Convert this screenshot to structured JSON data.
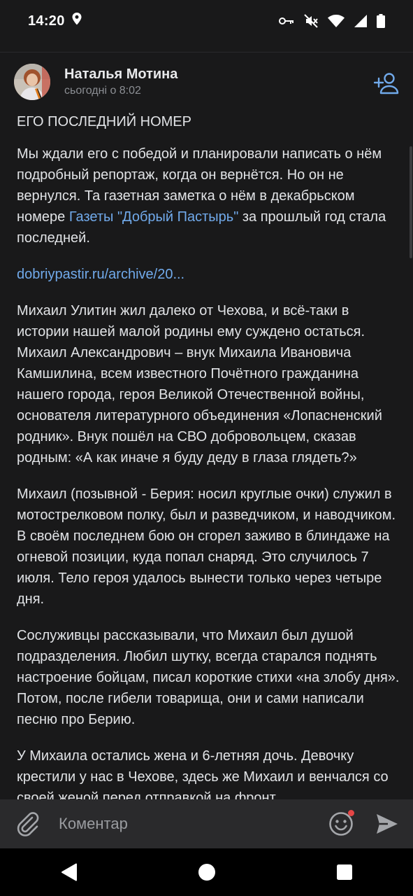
{
  "status_bar": {
    "time": "14:20",
    "icons": [
      "location-icon",
      "key-icon",
      "mute-icon",
      "wifi-icon",
      "signal-icon",
      "battery-icon"
    ]
  },
  "post": {
    "author_name": "Наталья Мотина",
    "time": "сьогодні о 8:02",
    "title": "ЕГО ПОСЛЕДНИЙ НОМЕР",
    "p1_before": "Мы ждали его с победой и планировали написать о нём подробный репортаж, когда он вернётся. Но он не вернулся. Та газетная заметка о нём в декабрьском номере ",
    "p1_link": "Газеты \"Добрый Пастырь\"",
    "p1_after": " за прошлый год стала последней.",
    "archive_link": "dobriypastir.ru/archive/20...",
    "p2": "Михаил Улитин жил далеко от Чехова, и всё-таки в истории нашей малой родины ему суждено остаться. Михаил Александрович – внук Михаила Ивановича Камшилина, всем известного Почётного гражданина нашего города, героя Великой Отечественной войны, основателя литературного объединения «Лопасненский родник». Внук пошёл на СВО добровольцем, сказав родным: «А как иначе я буду деду в глаза глядеть?»",
    "p3": "Михаил (позывной - Берия: носил круглые очки) служил в мотострелковом полку, был и разведчиком, и наводчиком. В своём последнем бою он сгорел заживо в блиндаже на огневой позиции, куда попал снаряд. Это случилось 7 июля. Тело героя удалось вынести только через четыре дня.",
    "p4": "Сослуживцы рассказывали, что Михаил был душой подразделения. Любил шутку, всегда старался поднять настроение бойцам, писал короткие стихи «на злобу дня». Потом, после гибели товарища, они и сами написали песню про Берию.",
    "p5": "У Михаила остались жена и 6-летняя дочь. Девочку крестили у нас в Чехове, здесь же Михаил и венчался со своей женой перед отправкой на фронт."
  },
  "comment_bar": {
    "placeholder": "Коментар"
  },
  "colors": {
    "background": "#19191a",
    "accent": "#71aaeb",
    "comment_bar": "#2a2a2c",
    "notification_dot": "#e64646"
  }
}
